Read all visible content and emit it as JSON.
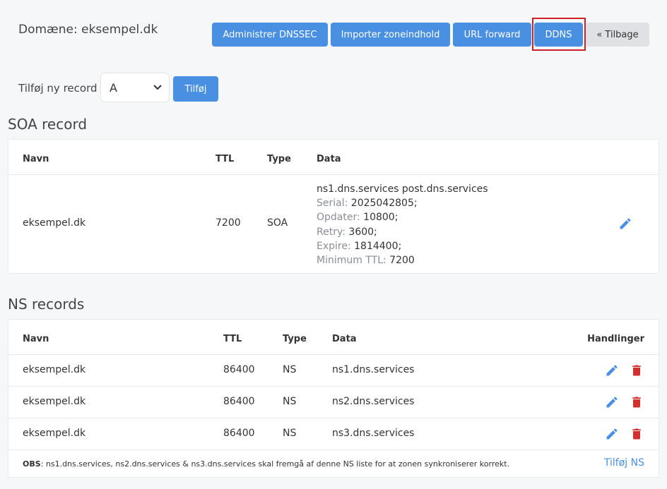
{
  "header": {
    "domain_title": "Domæne: eksempel.dk",
    "buttons": {
      "dnssec": "Administrer DNSSEC",
      "import": "Importer zoneindhold",
      "url_forward": "URL forward",
      "ddns": "DDNS",
      "back": "« Tilbage"
    }
  },
  "add_record": {
    "label": "Tilføj ny record",
    "selected_type": "A",
    "button": "Tilføj"
  },
  "soa": {
    "title": "SOA record",
    "headers": {
      "name": "Navn",
      "ttl": "TTL",
      "type": "Type",
      "data": "Data"
    },
    "row": {
      "name": "eksempel.dk",
      "ttl": "7200",
      "type": "SOA",
      "data_main": "ns1.dns.services post.dns.services",
      "serial_label": "Serial:",
      "serial": "2025042805;",
      "refresh_label": "Opdater:",
      "refresh": "10800;",
      "retry_label": "Retry:",
      "retry": "3600;",
      "expire_label": "Expire:",
      "expire": "1814400;",
      "min_ttl_label": "Minimum TTL:",
      "min_ttl": "7200"
    }
  },
  "ns": {
    "title": "NS records",
    "headers": {
      "name": "Navn",
      "ttl": "TTL",
      "type": "Type",
      "data": "Data",
      "actions": "Handlinger"
    },
    "rows": [
      {
        "name": "eksempel.dk",
        "ttl": "86400",
        "type": "NS",
        "data": "ns1.dns.services"
      },
      {
        "name": "eksempel.dk",
        "ttl": "86400",
        "type": "NS",
        "data": "ns2.dns.services"
      },
      {
        "name": "eksempel.dk",
        "ttl": "86400",
        "type": "NS",
        "data": "ns3.dns.services"
      }
    ],
    "note_label": "OBS",
    "note_text": ": ns1.dns.services, ns2.dns.services & ns3.dns.services skal fremgå af denne NS liste for at zonen synkroniserer korrekt.",
    "add_ns": "Tilføj NS"
  },
  "colors": {
    "primary": "#4a90e2",
    "danger": "#d0302e",
    "highlight": "#d0202a"
  },
  "icons": {
    "edit": "pencil-icon",
    "delete": "trash-icon",
    "select": "chevron-down-icon"
  }
}
